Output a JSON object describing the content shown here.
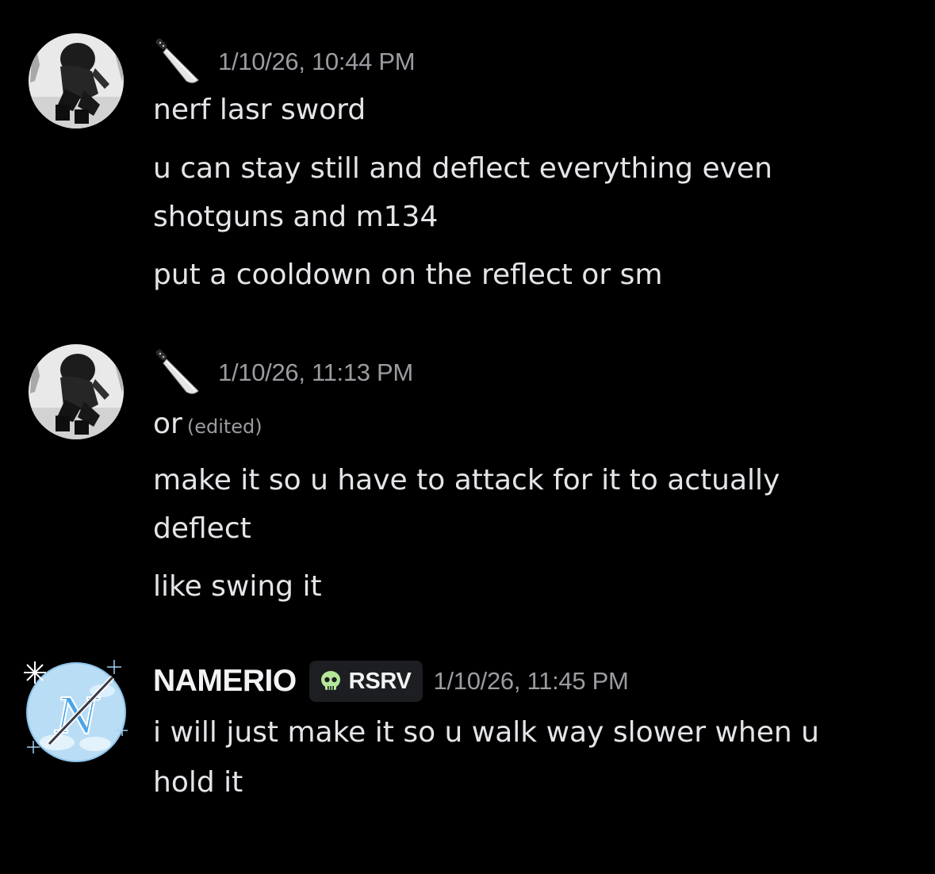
{
  "messages": [
    {
      "timestamp": "1/10/26, 10:44 PM",
      "lines": [
        "nerf lasr sword",
        "u can stay still and deflect everything even",
        "shotguns and m134",
        "put a cooldown on the reflect or sm"
      ]
    },
    {
      "timestamp": "1/10/26, 11:13 PM",
      "lines": [
        "or",
        "make it so u have to attack for it to actually",
        "deflect",
        "like swing it"
      ],
      "edited": "(edited)"
    },
    {
      "username": "NAMERIO",
      "tag": "RSRV",
      "timestamp": "1/10/26, 11:45 PM",
      "lines": [
        "i will just make it so u walk way slower when u",
        "hold it"
      ]
    }
  ],
  "icons": {
    "author_badge": "knife-icon",
    "tag_icon": "skull-icon"
  },
  "colors": {
    "background": "#000000",
    "text": "#e3e5e8",
    "muted": "#9a9ca1",
    "tag_background": "#1d1e21",
    "skull": "#b5e79a",
    "avatar_blue": "#b9ddf4"
  }
}
